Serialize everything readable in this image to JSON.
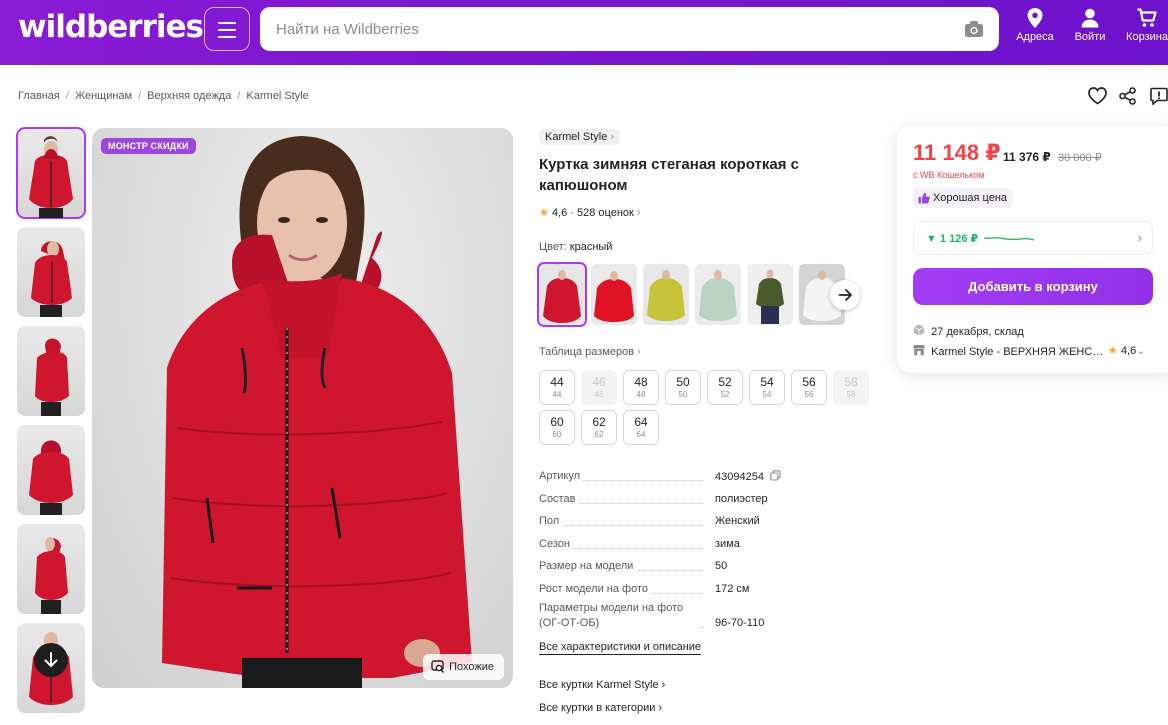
{
  "header": {
    "logo": "wildberries",
    "search_placeholder": "Найти на Wildberries",
    "nav": {
      "address": "Адреса",
      "login": "Войти",
      "cart": "Корзина"
    }
  },
  "breadcrumbs": [
    "Главная",
    "Женщинам",
    "Верхняя одежда",
    "Karmel Style"
  ],
  "gallery": {
    "badge": "МОНСТР СКИДКИ",
    "similar": "Похожие"
  },
  "product": {
    "brand": "Karmel Style",
    "title": "Куртка зимняя стеганая короткая с капюшоном",
    "rating": "4,6",
    "reviews": "528 оценок",
    "color_label": "Цвет:",
    "color_value": "красный",
    "size_table_label": "Таблица размеров",
    "sizes": [
      {
        "ru": "44",
        "eu": "44",
        "available": true
      },
      {
        "ru": "46",
        "eu": "46",
        "available": false
      },
      {
        "ru": "48",
        "eu": "48",
        "available": true
      },
      {
        "ru": "50",
        "eu": "50",
        "available": true
      },
      {
        "ru": "52",
        "eu": "52",
        "available": true
      },
      {
        "ru": "54",
        "eu": "54",
        "available": true
      },
      {
        "ru": "56",
        "eu": "56",
        "available": true
      },
      {
        "ru": "58",
        "eu": "58",
        "available": false
      },
      {
        "ru": "60",
        "eu": "60",
        "available": true
      },
      {
        "ru": "62",
        "eu": "62",
        "available": true
      },
      {
        "ru": "64",
        "eu": "64",
        "available": true
      }
    ],
    "specs": [
      {
        "k": "Артикул",
        "v": "43094254"
      },
      {
        "k": "Состав",
        "v": "полиэстер"
      },
      {
        "k": "Пол",
        "v": "Женский"
      },
      {
        "k": "Сезон",
        "v": "зима"
      },
      {
        "k": "Размер на модели",
        "v": "50"
      },
      {
        "k": "Рост модели на фото",
        "v": "172 см"
      },
      {
        "k": "Параметры модели на фото (ОГ-ОТ-ОБ)",
        "v": "96-70-110"
      }
    ],
    "all_specs_link": "Все характеристики и описание",
    "brand_link": "Все куртки Karmel Style",
    "category_link": "Все куртки в категории"
  },
  "buy": {
    "price": "11 148 ₽",
    "price_no_wallet": "11 376 ₽",
    "old_price": "30 000 ₽",
    "wallet_note": "с WB Кошельком",
    "good_price": "Хорошая цена",
    "trend": "▼ 1 126 ₽",
    "add_to_cart": "Добавить в корзину",
    "delivery": "27 декабря, склад",
    "seller": "Karmel Style - ВЕРХНЯЯ ЖЕНС…",
    "seller_rating": "4,6"
  },
  "colors": {
    "accent": "#a73afd",
    "header": "#7b16d0",
    "price": "#f2424a",
    "trend": "#16b865"
  }
}
